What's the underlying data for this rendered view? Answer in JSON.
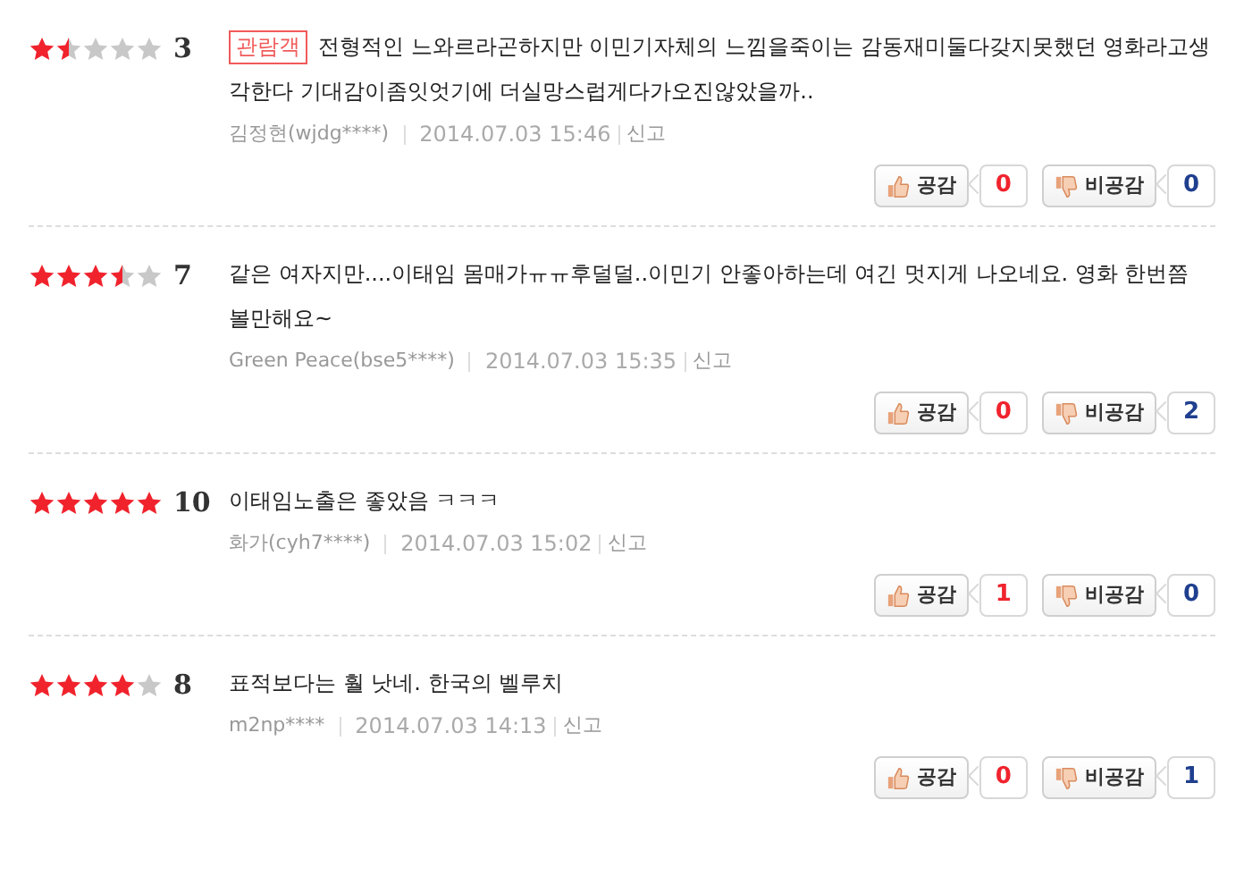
{
  "reviews": [
    {
      "stars": 1.5,
      "score": "3",
      "badge": "관람객",
      "text": "전형적인 느와르라곤하지만 이민기자체의 느낌을죽이는 감동재미둘다갖지못했던 영화라고생각한다 기대감이좀잇엇기에 더실망스럽게다가오진않았을까..",
      "author": "김정현(wjdg****)",
      "date": "2014.07.03 15:46",
      "report": "신고",
      "like_label": "공감",
      "likes": "0",
      "dislike_label": "비공감",
      "dislikes": "0"
    },
    {
      "stars": 3.5,
      "score": "7",
      "text": "같은 여자지만....이태임 몸매가ㅠㅠ후덜덜..이민기 안좋아하는데 여긴 멋지게 나오네요. 영화 한번쯤 볼만해요~",
      "author": "Green Peace(bse5****)",
      "date": "2014.07.03 15:35",
      "report": "신고",
      "like_label": "공감",
      "likes": "0",
      "dislike_label": "비공감",
      "dislikes": "2"
    },
    {
      "stars": 5,
      "score": "10",
      "text": "이태임노출은 좋았음 ㅋㅋㅋ",
      "author": "화가(cyh7****)",
      "date": "2014.07.03 15:02",
      "report": "신고",
      "like_label": "공감",
      "likes": "1",
      "dislike_label": "비공감",
      "dislikes": "0"
    },
    {
      "stars": 4,
      "score": "8",
      "text": "표적보다는 훨 낫네. 한국의 벨루치",
      "author": "m2np****",
      "date": "2014.07.03 14:13",
      "report": "신고",
      "like_label": "공감",
      "likes": "0",
      "dislike_label": "비공감",
      "dislikes": "1"
    }
  ]
}
